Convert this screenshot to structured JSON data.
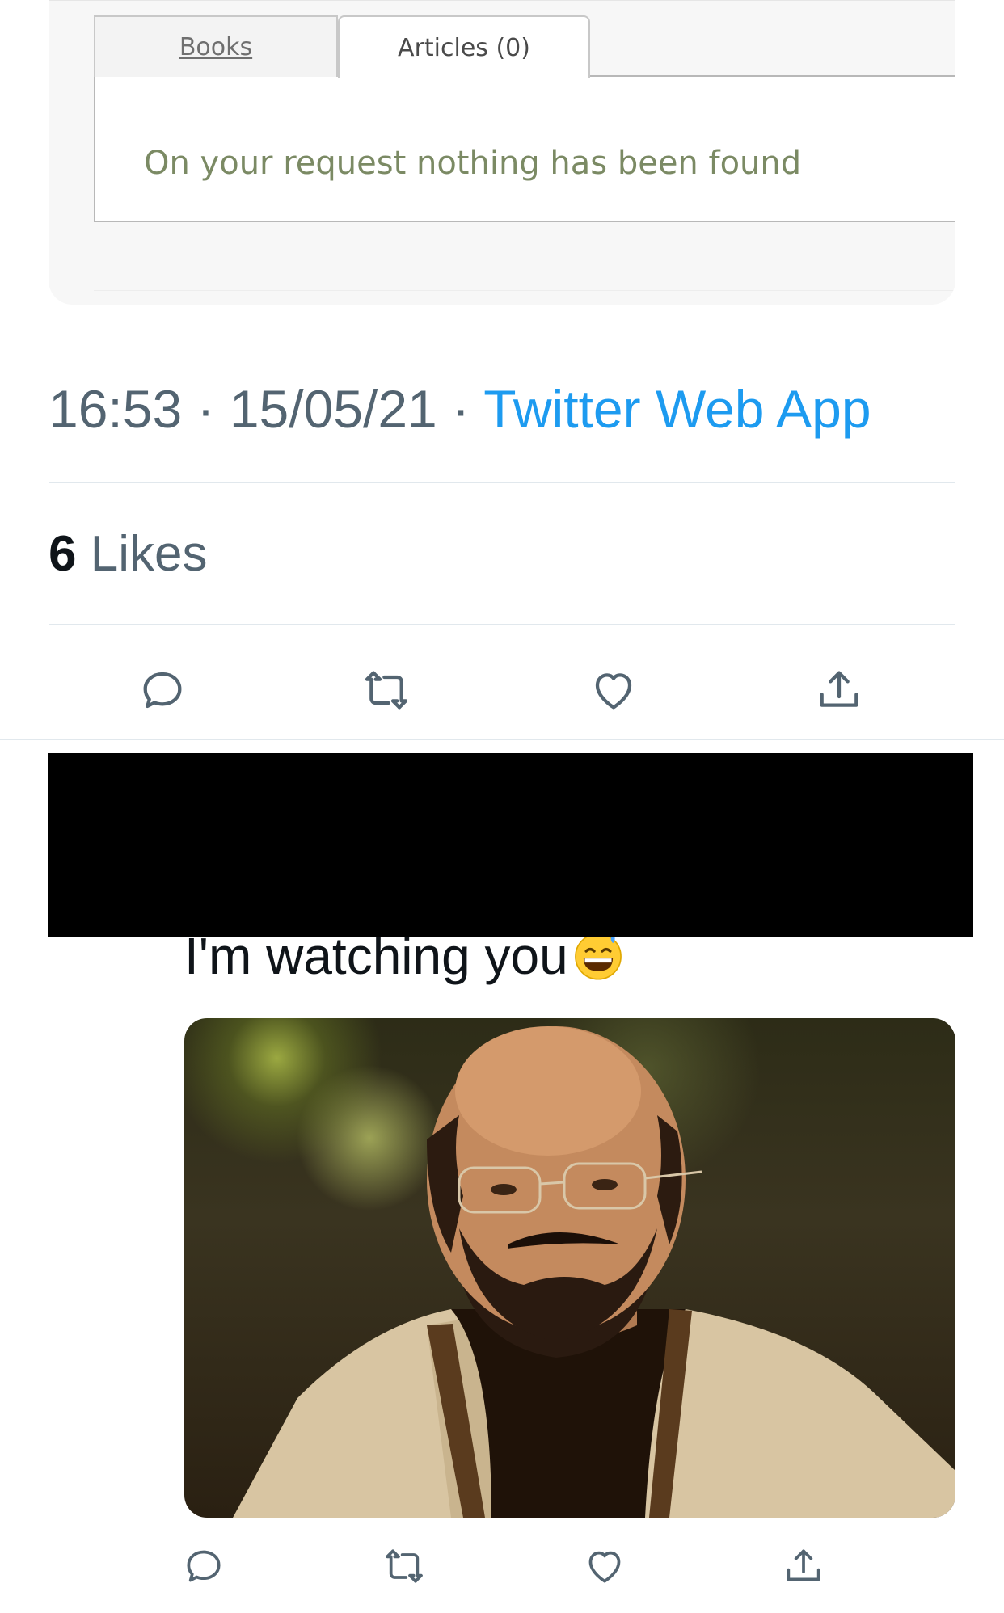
{
  "embedded_card": {
    "tabs": [
      {
        "label": "Books",
        "active": false
      },
      {
        "label": "Articles (0)",
        "active": true
      }
    ],
    "empty_message": "On your request nothing has been found"
  },
  "tweet1": {
    "time": "16:53",
    "date": "15/05/21",
    "separator": "·",
    "source": "Twitter Web App",
    "likes_count": "6",
    "likes_label": "Likes",
    "actions": [
      "reply-icon",
      "retweet-icon",
      "like-icon",
      "share-icon"
    ]
  },
  "tweet2": {
    "text": "I'm watching you",
    "emoji": "grinning-face-with-sweat",
    "actions": [
      "reply-icon",
      "retweet-icon",
      "like-icon",
      "share-icon"
    ]
  },
  "colors": {
    "link_blue": "#1d9bf0",
    "secondary_text": "#536471",
    "icon_gray": "#536471",
    "divider": "#e1e8ed"
  }
}
